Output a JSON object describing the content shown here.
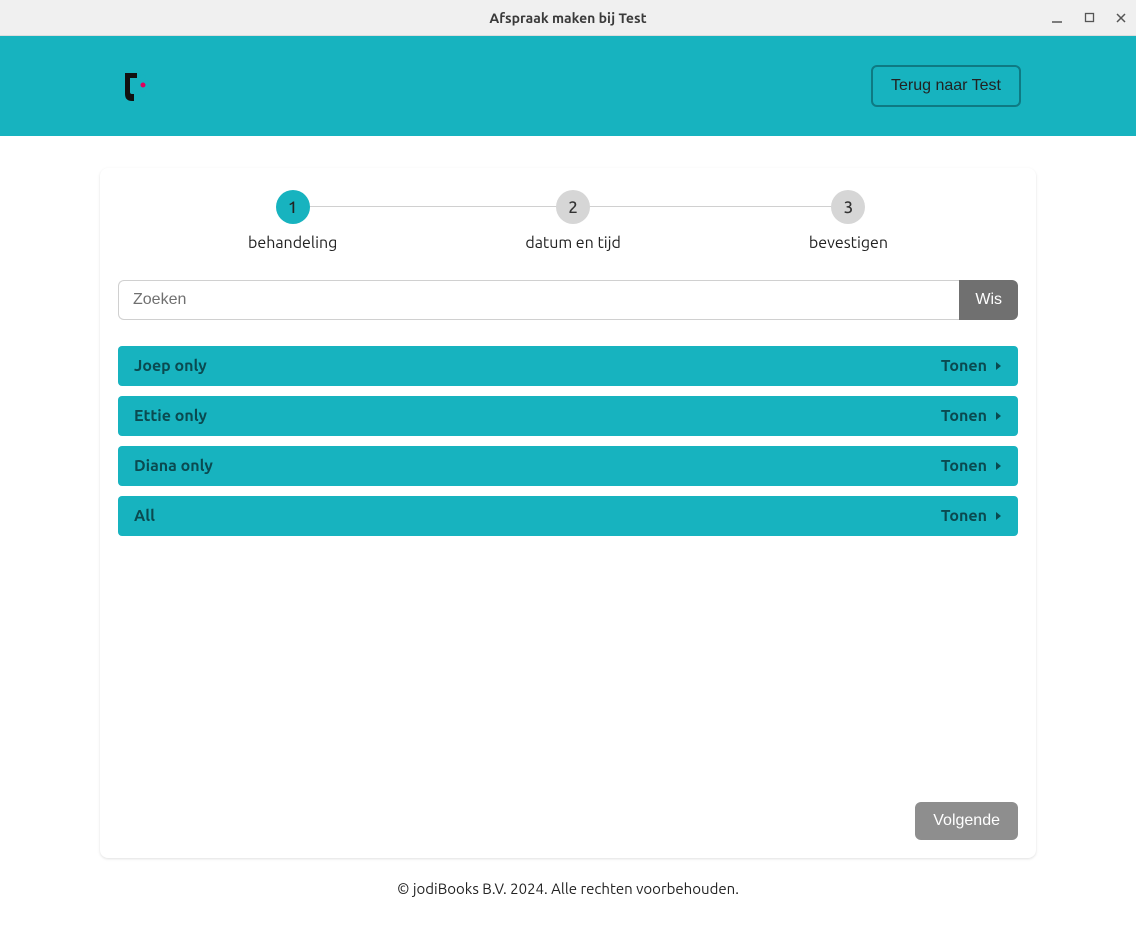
{
  "window": {
    "title": "Afspraak maken bij Test"
  },
  "header": {
    "back_button": "Terug naar Test"
  },
  "stepper": {
    "steps": [
      {
        "num": "1",
        "label": "behandeling",
        "active": true
      },
      {
        "num": "2",
        "label": "datum en tijd",
        "active": false
      },
      {
        "num": "3",
        "label": "bevestigen",
        "active": false
      }
    ]
  },
  "search": {
    "placeholder": "Zoeken",
    "clear_label": "Wis"
  },
  "categories": [
    {
      "name": "Joep only",
      "toggle": "Tonen"
    },
    {
      "name": "Ettie only",
      "toggle": "Tonen"
    },
    {
      "name": "Diana only",
      "toggle": "Tonen"
    },
    {
      "name": "All",
      "toggle": "Tonen"
    }
  ],
  "actions": {
    "next": "Volgende"
  },
  "footer": {
    "copyright": "© jodiBooks B.V. 2024. Alle rechten voorbehouden."
  }
}
